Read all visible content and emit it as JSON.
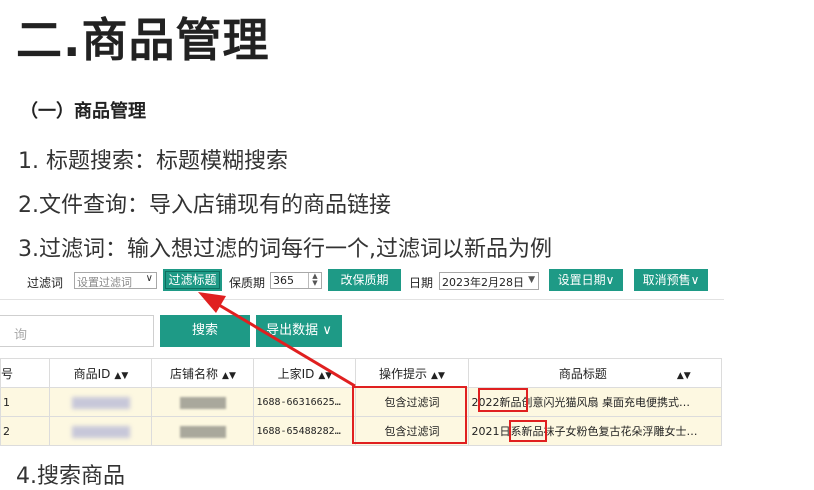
{
  "page_title": "二.商品管理",
  "section_title": "（一）商品管理",
  "steps": [
    "1. 标题搜索：标题模糊搜索",
    "2.文件查询：导入店铺现有的商品链接",
    "3.过滤词：输入想过滤的词每行一个,过滤词以新品为例"
  ],
  "bottom_cut_text": "4.搜索商品",
  "toolbar": {
    "filter_label": "过滤词",
    "filter_select_value": "设置过滤词",
    "filter_title_button": "过滤标题",
    "shelf_life_label": "保质期",
    "shelf_life_value": "365",
    "change_shelf_life_button": "改保质期",
    "date_label": "日期",
    "date_value": "2023年2月28日",
    "set_date_button": "设置日期",
    "cancel_presale_button": "取消预售"
  },
  "search": {
    "placeholder": "询",
    "search_button": "搜索",
    "export_button": "导出数据"
  },
  "table": {
    "headers": [
      "序号",
      "商品ID",
      "店铺名称",
      "上家ID",
      "操作提示",
      "商品标题"
    ],
    "header_visible": [
      "号",
      "商品ID",
      "店铺名称",
      "上家ID",
      "操作提示",
      "商品标题"
    ],
    "rows": [
      {
        "index": "1",
        "upstream_id": "1688-66316625…",
        "hint": "包含过滤词",
        "title_prefix": "2022",
        "title_highlight": "新品",
        "title_rest": "创意闪光猫风扇   桌面充电便携式…"
      },
      {
        "index": "2",
        "upstream_id": "1688-65488282…",
        "hint": "包含过滤词",
        "title_prefix": "2021日系",
        "title_highlight": "新品",
        "title_rest": "袜子女粉色复古花朵浮雕女士…"
      }
    ]
  },
  "colors": {
    "accent_green": "#1e9a86",
    "highlight_red": "#e02020",
    "row_background": "#fdf8e1"
  }
}
